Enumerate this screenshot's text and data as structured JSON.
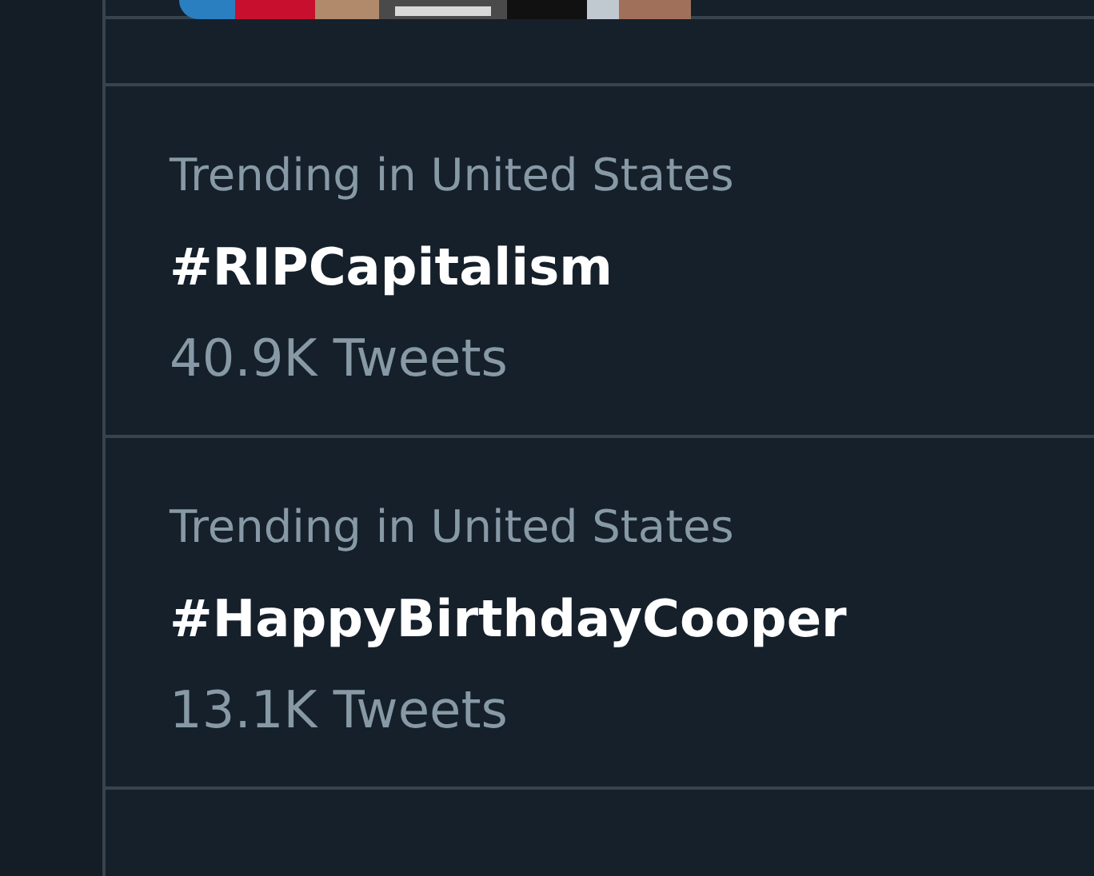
{
  "trends": [
    {
      "context": "Trending in United States",
      "name": "#RIPCapitalism",
      "count": "40.9K Tweets"
    },
    {
      "context": "Trending in United States",
      "name": "#HappyBirthdayCooper",
      "count": "13.1K Tweets"
    }
  ]
}
